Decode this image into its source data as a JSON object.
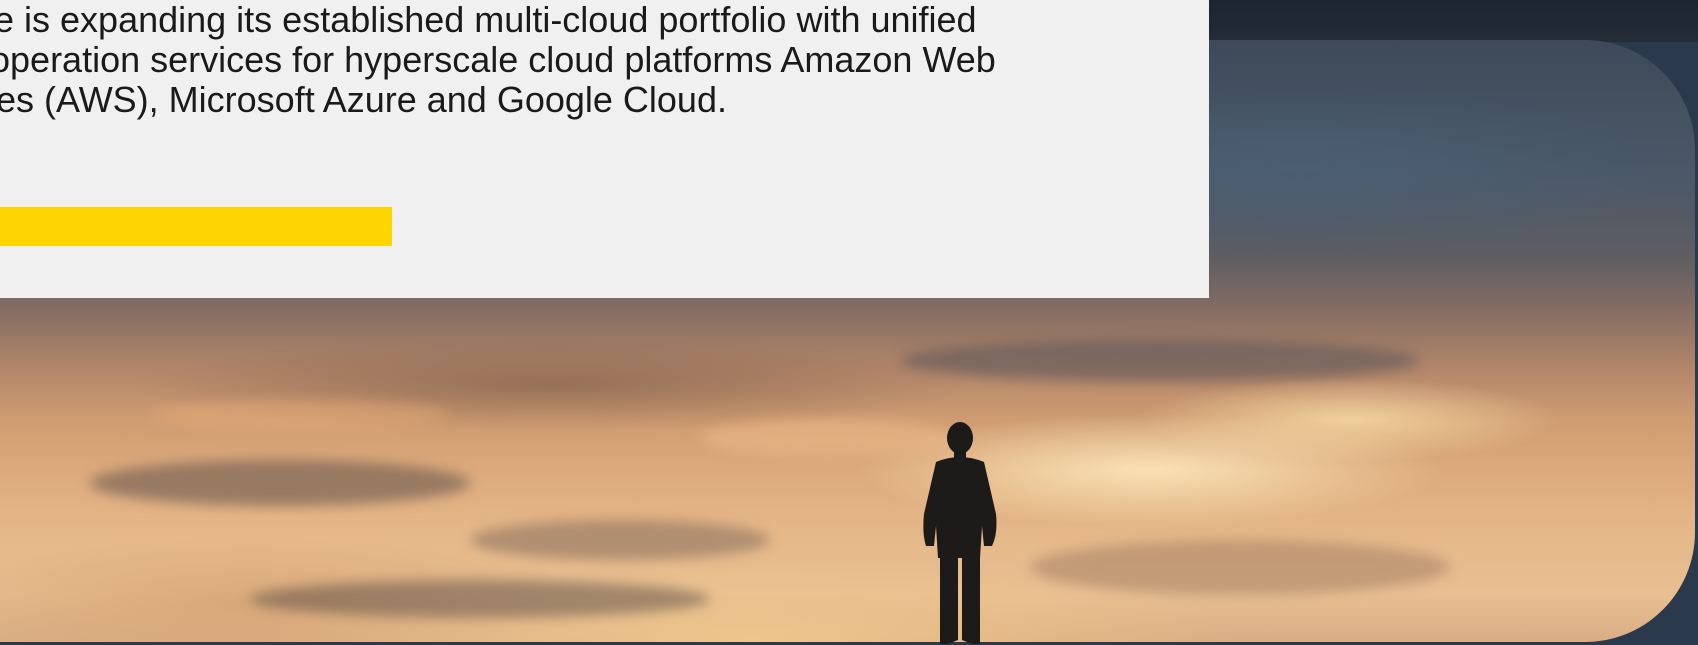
{
  "hero": {
    "intro_lines": [
      "e is expanding its established multi-cloud portfolio with unified",
      "operation services for hyperscale cloud platforms Amazon Web",
      "es (AWS), Microsoft Azure and Google Cloud."
    ],
    "cta_color": "#ffd500",
    "panel_color": "#f0f0f1"
  },
  "image": {
    "description_icon": "person-silhouette-icon"
  }
}
